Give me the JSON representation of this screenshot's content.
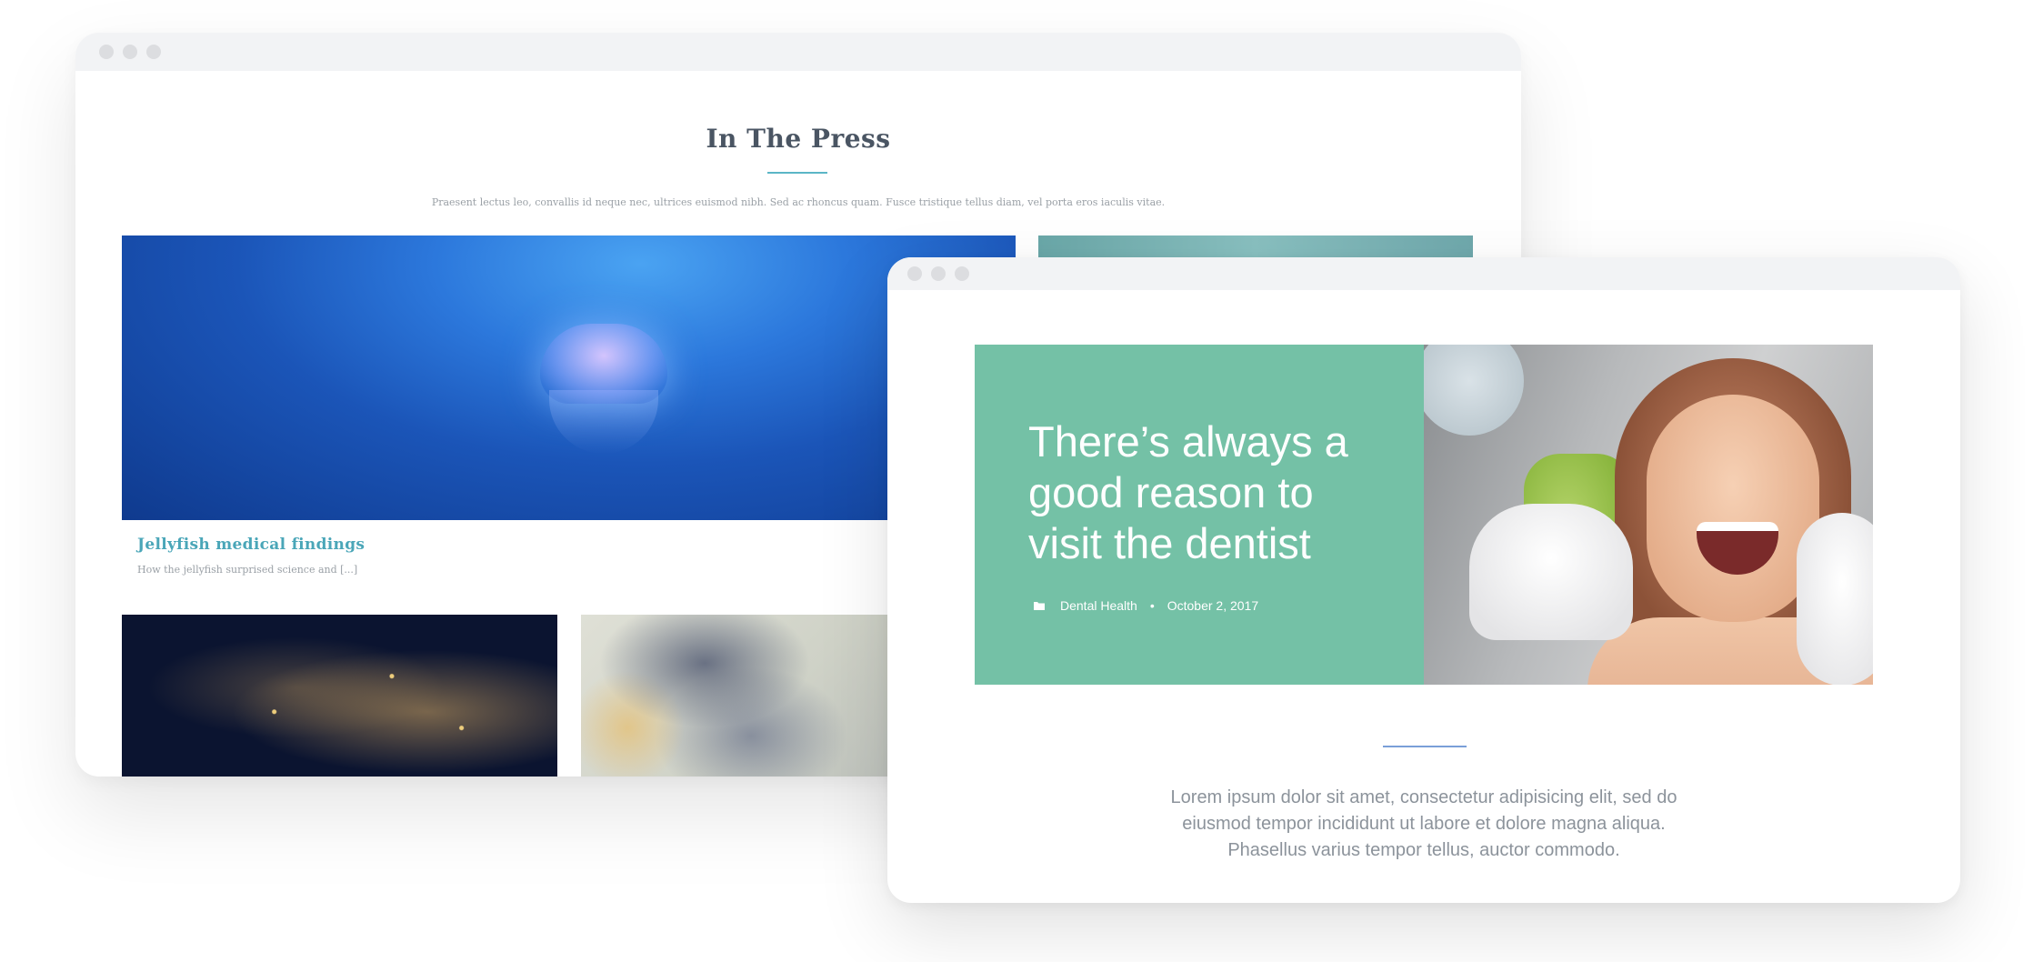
{
  "back_window": {
    "title": "In The Press",
    "subtitle": "Praesent lectus leo, convallis id neque nec, ultrices euismod nibh. Sed ac rhoncus quam. Fusce tristique tellus diam, vel porta eros iaculis vitae.",
    "featured_card": {
      "title": "Jellyfish medical findings",
      "excerpt": "How the jellyfish surprised science and [...]"
    }
  },
  "front_window": {
    "hero": {
      "heading": "There’s always a good reason to visit the dentist",
      "category": "Dental Health",
      "separator": "•",
      "date": "October 2, 2017",
      "category_icon": "folder-icon"
    },
    "body_text": "Lorem ipsum dolor sit amet, consectetur adipisicing elit, sed do eiusmod tempor incididunt ut labore et dolore magna aliqua. Phasellus varius tempor tellus, auctor commodo."
  },
  "colors": {
    "hero_green": "#74c1a6",
    "accent_teal": "#4aa6b8",
    "accent_blue": "#7a9fd8"
  }
}
